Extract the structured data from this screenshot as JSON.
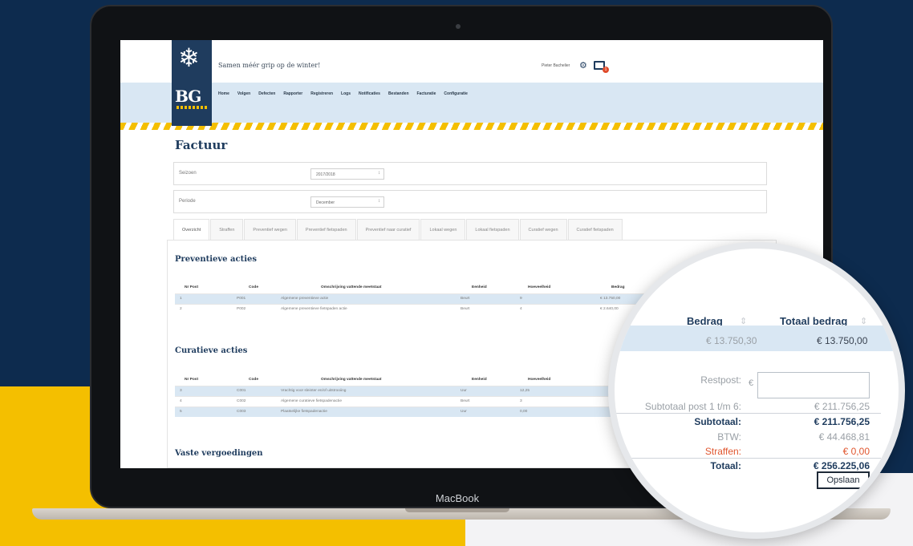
{
  "device": {
    "brand": "MacBook"
  },
  "app": {
    "logo_text": "BG",
    "tagline": "Samen méér grip op de winter!",
    "user_name": "Pieter Bachelier",
    "notification_count": "1",
    "nav": [
      "Home",
      "Volgen",
      "Defecten",
      "Rapporter",
      "Registreren",
      "Logs",
      "Notificaties",
      "Bestanden",
      "Facturatie",
      "Configuratie"
    ]
  },
  "page": {
    "title": "Factuur",
    "filters": [
      {
        "label": "Seizoen",
        "value": "2017/2018"
      },
      {
        "label": "Periode",
        "value": "December"
      }
    ],
    "tabs": [
      "Overzicht",
      "Straffen",
      "Preventief wegen",
      "Preventief fietspaden",
      "Preventief naar curatief",
      "Lokaal wegen",
      "Lokaal fietspaden",
      "Curatief wegen",
      "Curatief fietspaden"
    ]
  },
  "preventive": {
    "title": "Preventieve acties",
    "headers": [
      "Nr Post",
      "Code",
      "Omschrijving vattende meetstaat",
      "Eenheid",
      "Hoeveelheid",
      "Bedrag"
    ],
    "rows": [
      [
        "1",
        "P001",
        "Algemene preventieve actie",
        "Beurt",
        "9",
        "€ 13.750,00"
      ],
      [
        "2",
        "P002",
        "Algemene preventieve fietspaden actie",
        "Beurt",
        "4",
        "€ 2.640,00"
      ]
    ]
  },
  "curative": {
    "title": "Curatieve acties",
    "headers": [
      "Nr Post",
      "Code",
      "Omschrijving vattende meetstaat",
      "Eenheid",
      "Hoeveelheid"
    ],
    "rows": [
      [
        "3",
        "C001",
        "Vrachtig voor sleinter en/of uitstrooiing",
        "Uur",
        "12,25"
      ],
      [
        "4",
        "C002",
        "Algemene curatieve fietspadenactie",
        "Beurt",
        "3"
      ],
      [
        "5",
        "C003",
        "Plaatselijke fietspadenactie",
        "Uur",
        "0,00"
      ]
    ]
  },
  "fixed": {
    "title": "Vaste vergoedingen"
  },
  "zoom": {
    "col_bedrag": "Bedrag",
    "col_totaal": "Totaal bedrag",
    "row_bedrag": "€ 13.750,30",
    "row_totaal": "€ 13.750,00",
    "restpost_label": "Restpost:",
    "euro_symbol": "€",
    "summary": [
      {
        "label": "Subtotaal post 1 t/m 6:",
        "value": "€ 211.756,25"
      },
      {
        "label": "Subtotaal:",
        "value": "€ 211.756,25"
      },
      {
        "label": "BTW:",
        "value": "€ 44.468,81"
      },
      {
        "label": "Straffen:",
        "value": "€ 0,00"
      },
      {
        "label": "Totaal:",
        "value": "€ 256.225,06"
      }
    ],
    "save_label": "Opslaan",
    "accent_red": "#e0562f",
    "brand_navy": "#1f3c5e"
  }
}
